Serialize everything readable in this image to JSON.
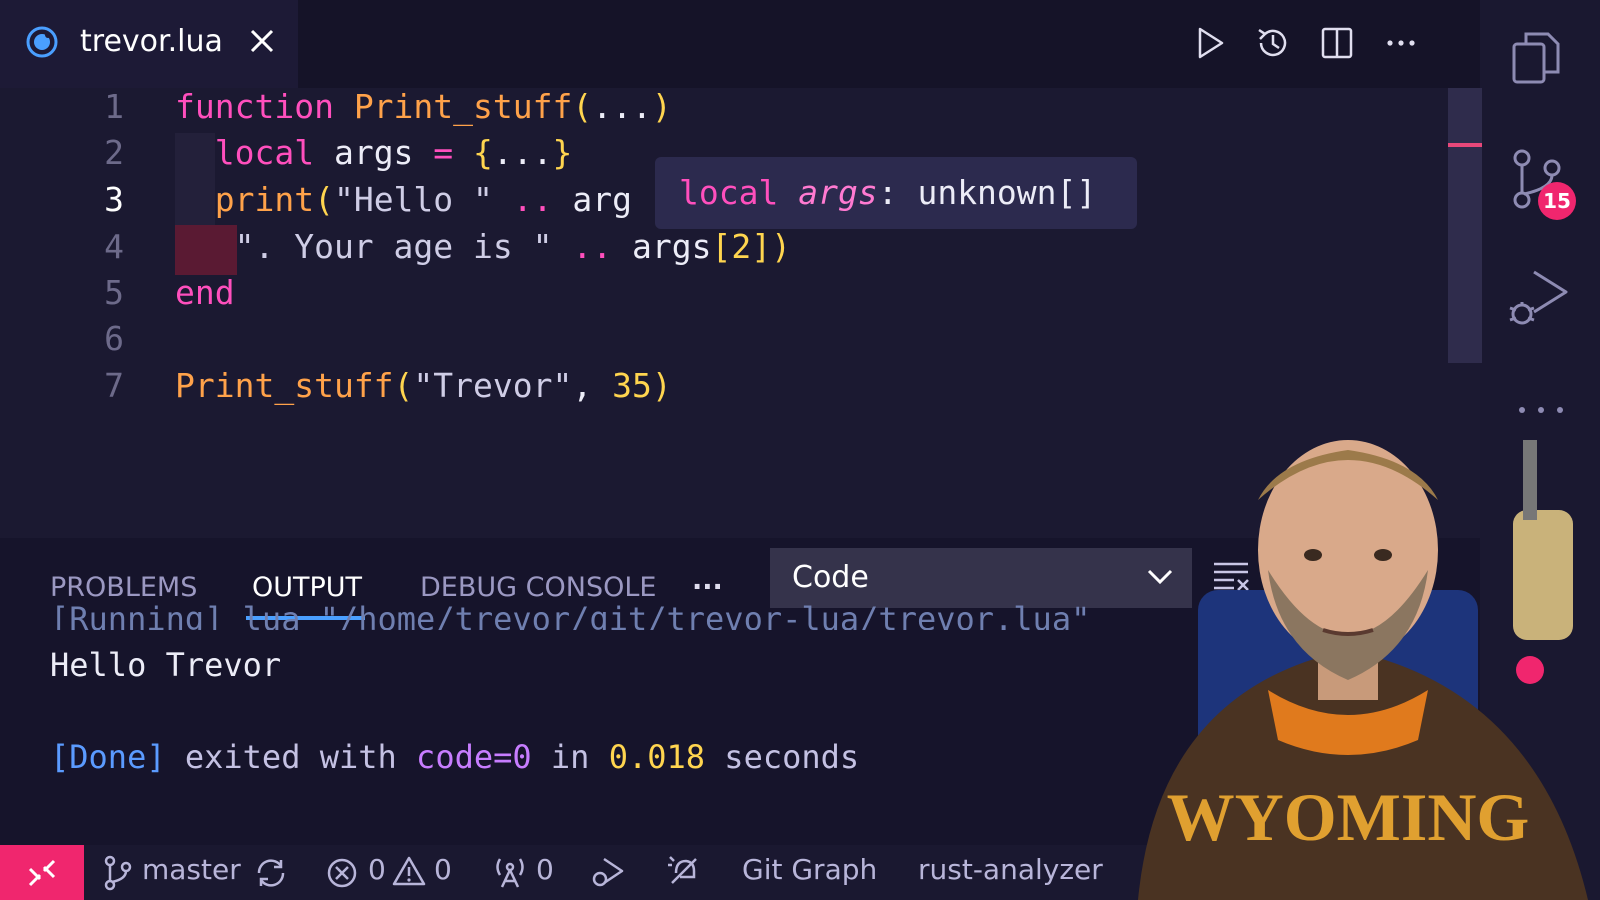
{
  "tab": {
    "filename": "trevor.lua"
  },
  "toolbar_icons": [
    "run-icon",
    "history-icon",
    "split-editor-icon",
    "more-actions-icon"
  ],
  "activity_bar": {
    "source_control_badge": "15"
  },
  "editor": {
    "active_line": 3,
    "lines": [
      {
        "n": "1",
        "tokens": [
          {
            "t": "function ",
            "c": "kw"
          },
          {
            "t": "Print_stuff",
            "c": "fn"
          },
          {
            "t": "(",
            "c": "paren"
          },
          {
            "t": "...",
            "c": "var"
          },
          {
            "t": ")",
            "c": "paren"
          }
        ]
      },
      {
        "n": "2",
        "tokens": [
          {
            "t": "  local ",
            "c": "kw"
          },
          {
            "t": "args ",
            "c": "var"
          },
          {
            "t": "= ",
            "c": "op"
          },
          {
            "t": "{",
            "c": "paren"
          },
          {
            "t": "...",
            "c": "var"
          },
          {
            "t": "}",
            "c": "paren"
          }
        ]
      },
      {
        "n": "3",
        "tokens": [
          {
            "t": "  print",
            "c": "fn"
          },
          {
            "t": "(",
            "c": "paren"
          },
          {
            "t": "\"Hello \" ",
            "c": "str"
          },
          {
            "t": ".. ",
            "c": "op"
          },
          {
            "t": "arg",
            "c": "var"
          }
        ]
      },
      {
        "n": "4",
        "tokens": [
          {
            "t": "   \". Your age is \" ",
            "c": "str"
          },
          {
            "t": ".. ",
            "c": "op"
          },
          {
            "t": "args",
            "c": "var"
          },
          {
            "t": "[2]",
            "c": "num"
          },
          {
            "t": ")",
            "c": "paren"
          }
        ]
      },
      {
        "n": "5",
        "tokens": [
          {
            "t": "end",
            "c": "kw"
          }
        ]
      },
      {
        "n": "6",
        "tokens": []
      },
      {
        "n": "7",
        "tokens": [
          {
            "t": "Print_stuff",
            "c": "fn"
          },
          {
            "t": "(",
            "c": "paren"
          },
          {
            "t": "\"Trevor\"",
            "c": "str"
          },
          {
            "t": ", ",
            "c": "var"
          },
          {
            "t": "35",
            "c": "num"
          },
          {
            "t": ")",
            "c": "paren"
          }
        ]
      }
    ],
    "hover": {
      "keyword": "local",
      "name": "args",
      "sep": ": ",
      "type": "unknown[]"
    }
  },
  "panel": {
    "tabs": [
      "PROBLEMS",
      "OUTPUT",
      "DEBUG CONSOLE"
    ],
    "active_tab": "OUTPUT",
    "more": "···",
    "output_channel": "Code",
    "output": {
      "running": "[Running] lua \"/home/trevor/git/trevor-lua/trevor.lua\"",
      "hello": "Hello Trevor",
      "done_tag": "[Done]",
      "done_exited": " exited with ",
      "done_code": "code=0",
      "done_in": " in ",
      "done_time": "0.018",
      "done_seconds": " seconds"
    }
  },
  "statusbar": {
    "branch": "master",
    "errors": "0",
    "warnings": "0",
    "ports": "0",
    "git_graph": "Git Graph",
    "language_server": "rust-analyzer"
  },
  "colors": {
    "accent": "#f0266e",
    "keyword": "#ff4fbd",
    "function": "#ffa24a",
    "number": "#ffd54f",
    "tab_underline": "#4a9fff"
  }
}
